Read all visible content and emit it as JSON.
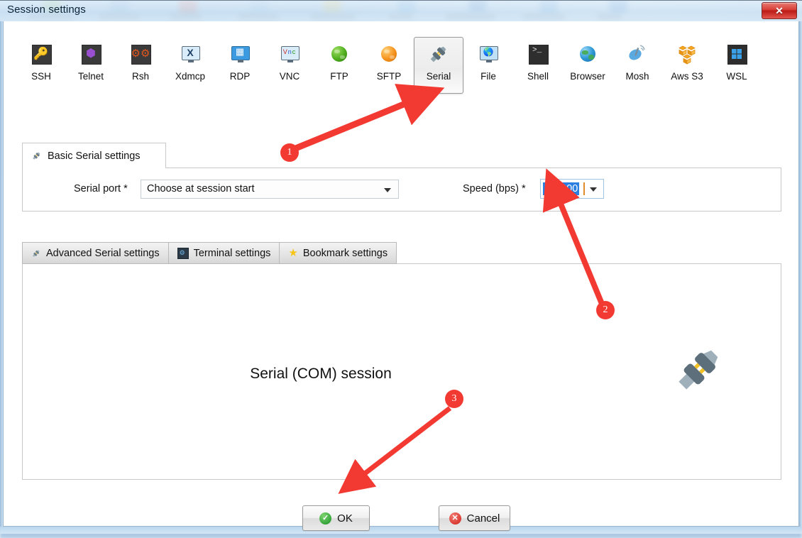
{
  "window": {
    "title": "Session settings",
    "close_label": "✕"
  },
  "protocols": [
    {
      "label": "SSH",
      "icon": "key-icon"
    },
    {
      "label": "Telnet",
      "icon": "cube-icon"
    },
    {
      "label": "Rsh",
      "icon": "gears-icon"
    },
    {
      "label": "Xdmcp",
      "icon": "x-window-icon"
    },
    {
      "label": "RDP",
      "icon": "windows-monitor-icon"
    },
    {
      "label": "VNC",
      "icon": "vnc-monitor-icon"
    },
    {
      "label": "FTP",
      "icon": "green-globe-icon"
    },
    {
      "label": "SFTP",
      "icon": "orange-globe-icon"
    },
    {
      "label": "Serial",
      "icon": "serial-plug-icon",
      "selected": true
    },
    {
      "label": "File",
      "icon": "file-globe-icon"
    },
    {
      "label": "Shell",
      "icon": "terminal-prompt-icon"
    },
    {
      "label": "Browser",
      "icon": "browser-globe-icon"
    },
    {
      "label": "Mosh",
      "icon": "satellite-dish-icon"
    },
    {
      "label": "Aws S3",
      "icon": "aws-cubes-icon"
    },
    {
      "label": "WSL",
      "icon": "windows-logo-icon"
    }
  ],
  "basic": {
    "tab_label": "Basic Serial settings",
    "tab_icon": "serial-plug-icon",
    "serial_port": {
      "label": "Serial port *",
      "value": "Choose at session start"
    },
    "speed": {
      "label": "Speed (bps) *",
      "value": "115200"
    }
  },
  "lower_tabs": [
    {
      "label": "Advanced Serial settings",
      "icon": "serial-plug-icon",
      "active": false
    },
    {
      "label": "Terminal settings",
      "icon": "terminal-settings-icon",
      "active": false
    },
    {
      "label": "Bookmark settings",
      "icon": "star-icon",
      "active": false
    }
  ],
  "content": {
    "session_title": "Serial (COM) session",
    "illustration": "serial-plug-illustration"
  },
  "footer": {
    "ok_label": "OK",
    "ok_icon": "check-circle-icon",
    "cancel_label": "Cancel",
    "cancel_icon": "x-circle-icon"
  },
  "annotations": [
    {
      "number": "1"
    },
    {
      "number": "2"
    },
    {
      "number": "3"
    }
  ],
  "colors": {
    "annotation_red": "#f33a32",
    "selection_blue": "#2a7fe0",
    "ok_green": "#35a53a",
    "cancel_red": "#db3b33"
  }
}
